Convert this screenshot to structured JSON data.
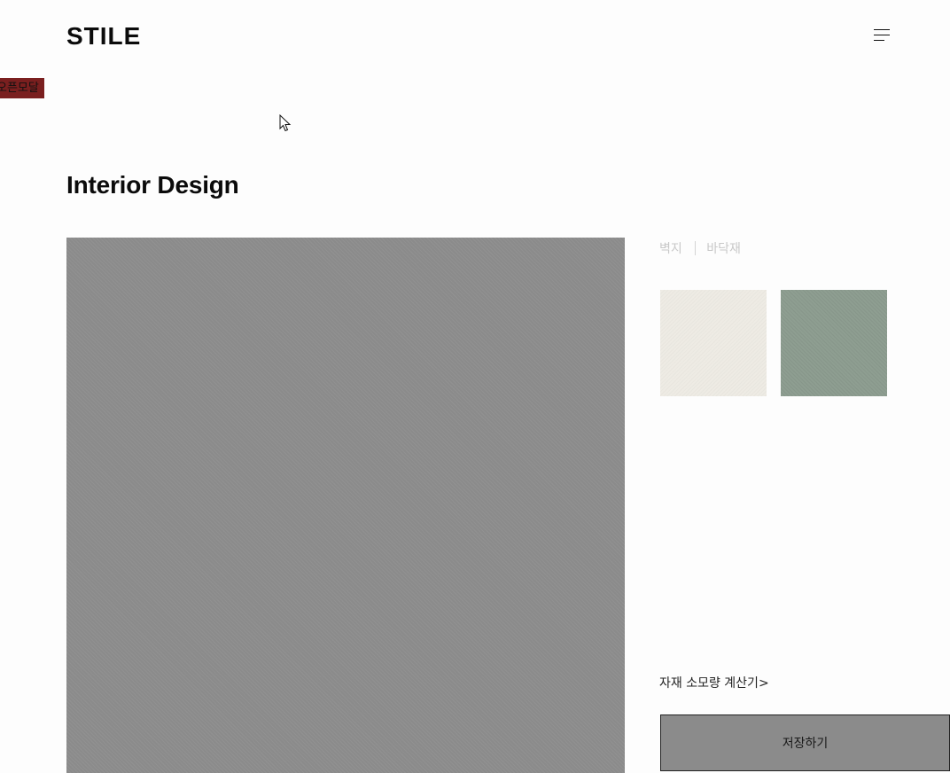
{
  "header": {
    "logo_text": "STILE",
    "menu_icon": "hamburger-menu-icon"
  },
  "open_modal_label": "오픈모달",
  "cursor_icon": "mouse-pointer-icon",
  "main": {
    "title": "Interior Design",
    "tabs": [
      {
        "label": "벽지"
      },
      {
        "label": "바닥재"
      }
    ],
    "swatches": [
      {
        "color": "#eeebe4"
      },
      {
        "color": "#8e9e91"
      }
    ],
    "calc_link": "자재 소모량 계산기>",
    "save_label": "저장하기"
  }
}
